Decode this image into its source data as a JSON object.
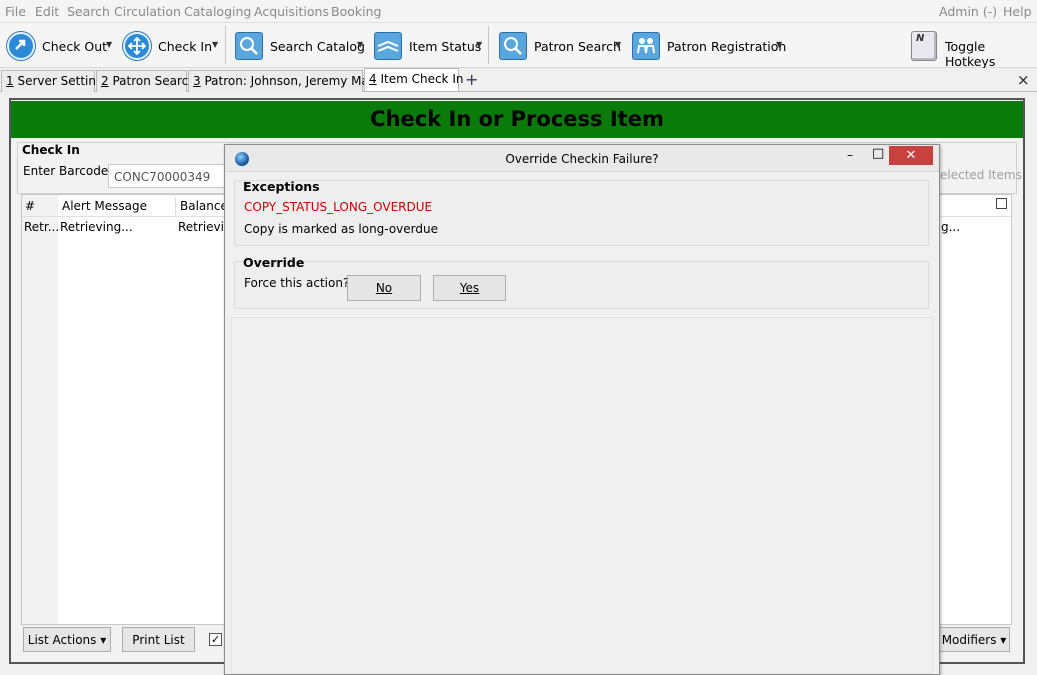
{
  "menubar": {
    "items": [
      "File",
      "Edit",
      "Search",
      "Circulation",
      "Cataloging",
      "Acquisitions",
      "Booking"
    ],
    "admin": "Admin (-)",
    "help": "Help"
  },
  "toolbar": {
    "check_out": "Check Out",
    "check_in": "Check In",
    "search_catalog": "Search Catalog",
    "item_status": "Item Status",
    "patron_search": "Patron Search",
    "patron_registration": "Patron Registration",
    "toggle_hotkeys": "Toggle Hotkeys",
    "hotkeys_key": "N"
  },
  "tabs": [
    {
      "num": "1",
      "label": " Server Settings"
    },
    {
      "num": "2",
      "label": " Patron Search"
    },
    {
      "num": "3",
      "label": " Patron: Johnson, Jeremy Mark"
    },
    {
      "num": "4",
      "label": " Item Check In"
    }
  ],
  "tab_add": "+",
  "tab_close": "×",
  "main": {
    "title": "Check In or Process Item",
    "checkin_group": "Check In",
    "barcode_label": "Enter Barcode:",
    "barcode_value": "CONC70000349",
    "selected_items": "elected Items",
    "columns": [
      "#",
      "Alert Message",
      "Balance"
    ],
    "row": [
      "Retr...",
      "Retrieving...",
      "Retrievin"
    ],
    "row_right": "g...",
    "list_actions": "List Actions",
    "print_list": "Print List",
    "modifiers": "Modifiers"
  },
  "dialog": {
    "title": "Override Checkin Failure?",
    "exceptions_legend": "Exceptions",
    "exception_code": "COPY_STATUS_LONG_OVERDUE",
    "exception_desc": "Copy is marked as long-overdue",
    "override_legend": "Override",
    "force_label": "Force this action?",
    "no_label": "No",
    "yes_label": "Yes",
    "minimize": "–",
    "maximize": "□",
    "close": "✕"
  },
  "colors": {
    "header_green": "#0a7a0a",
    "exception_red": "#cc0000",
    "close_red": "#c7413f"
  }
}
